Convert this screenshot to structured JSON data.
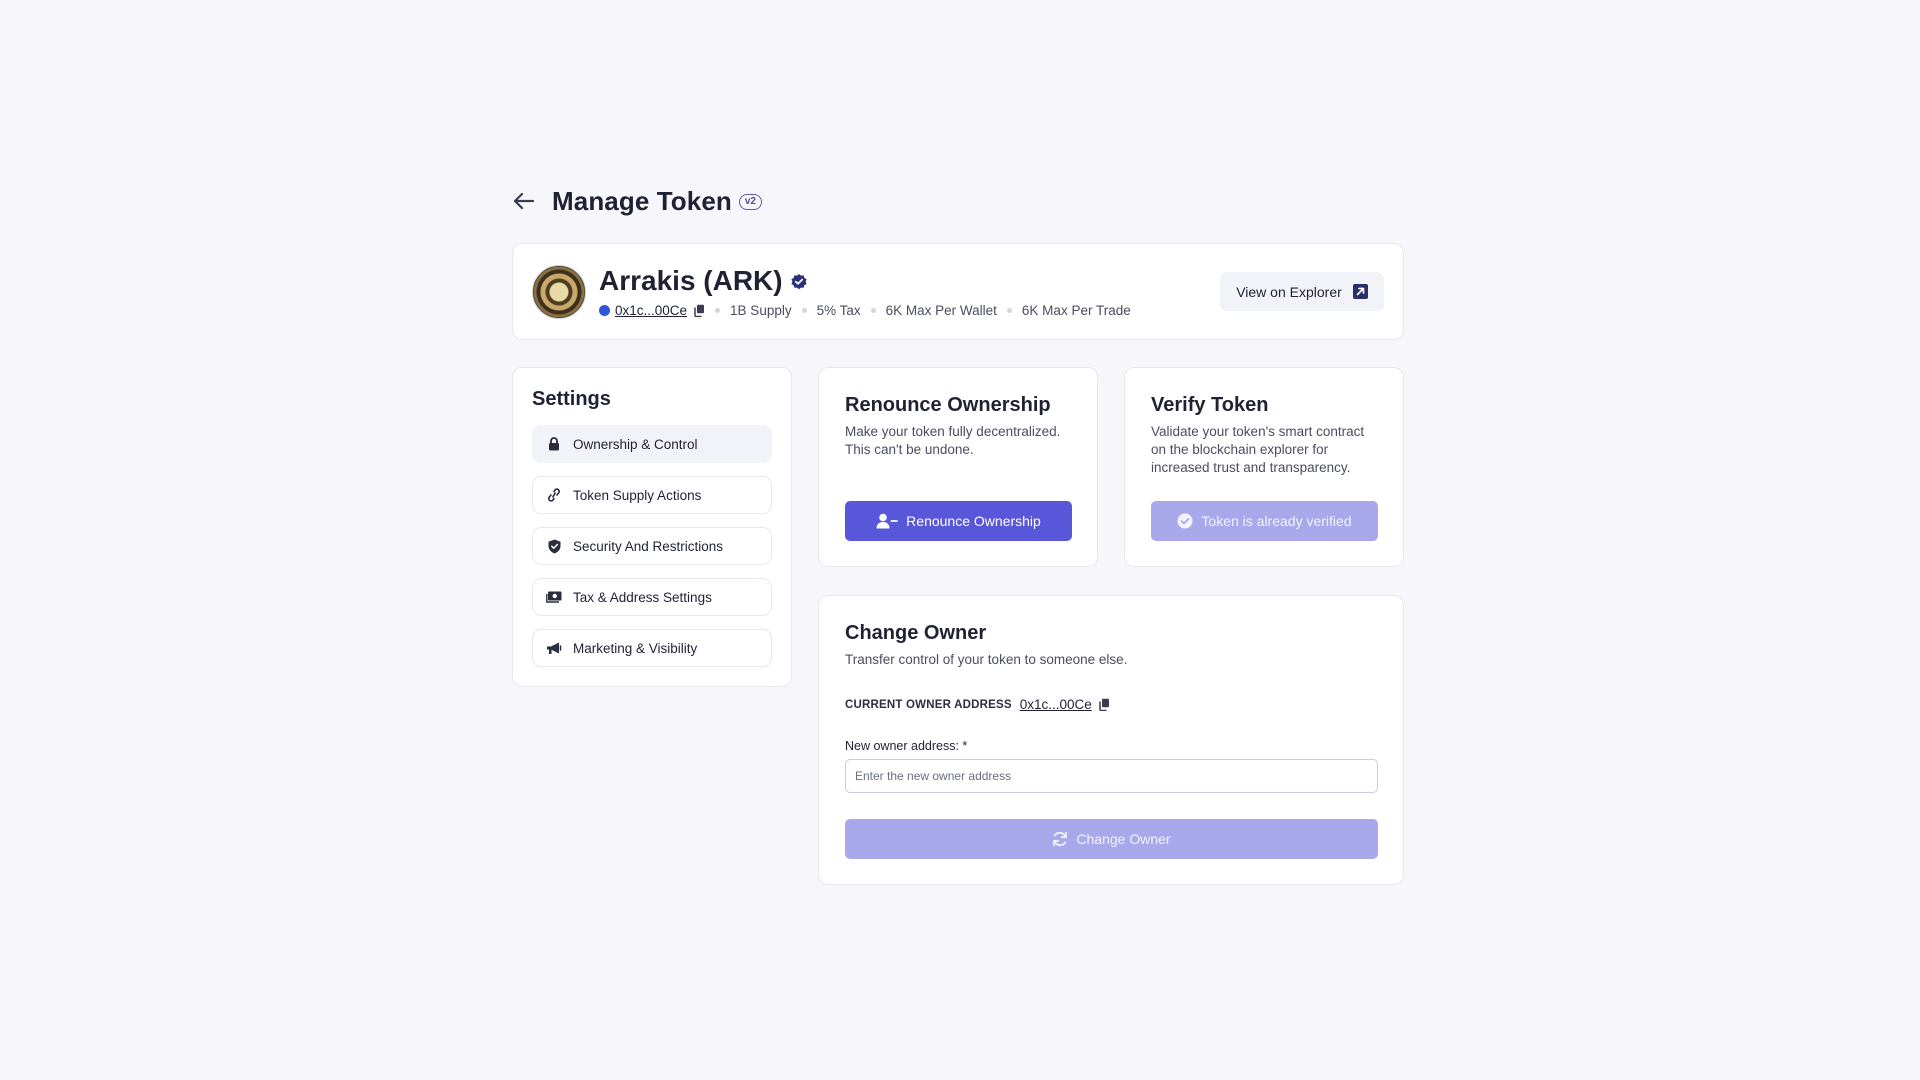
{
  "header": {
    "title": "Manage Token",
    "version": "v2"
  },
  "token": {
    "name": "Arrakis (ARK)",
    "address": "0x1c...00Ce",
    "supply": "1B Supply",
    "tax": "5% Tax",
    "max_wallet": "6K Max Per Wallet",
    "max_trade": "6K Max Per Trade",
    "explorer_label": "View on Explorer"
  },
  "settings": {
    "title": "Settings",
    "items": [
      {
        "label": "Ownership & Control",
        "icon": "lock-icon"
      },
      {
        "label": "Token Supply Actions",
        "icon": "link-icon"
      },
      {
        "label": "Security And Restrictions",
        "icon": "shield-icon"
      },
      {
        "label": "Tax & Address Settings",
        "icon": "money-icon"
      },
      {
        "label": "Marketing & Visibility",
        "icon": "megaphone-icon"
      }
    ]
  },
  "renounce": {
    "title": "Renounce Ownership",
    "desc_line1": "Make your token fully decentralized.",
    "desc_line2": "This can't be undone.",
    "button": "Renounce Ownership"
  },
  "verify": {
    "title": "Verify Token",
    "desc_line1": "Validate your token's smart contract",
    "desc_line2": "on the blockchain explorer for",
    "desc_line3": "increased trust and transparency.",
    "button": "Token is already verified"
  },
  "change_owner": {
    "title": "Change Owner",
    "desc": "Transfer control of your token to someone else.",
    "current_label": "CURRENT OWNER ADDRESS",
    "current_address": "0x1c...00Ce",
    "field_label": "New owner address: *",
    "placeholder": "Enter the new owner address",
    "button": "Change Owner"
  },
  "colors": {
    "accent": "#5957d9",
    "accent_disabled": "#a8a8ea",
    "background": "#f7f7fb"
  }
}
